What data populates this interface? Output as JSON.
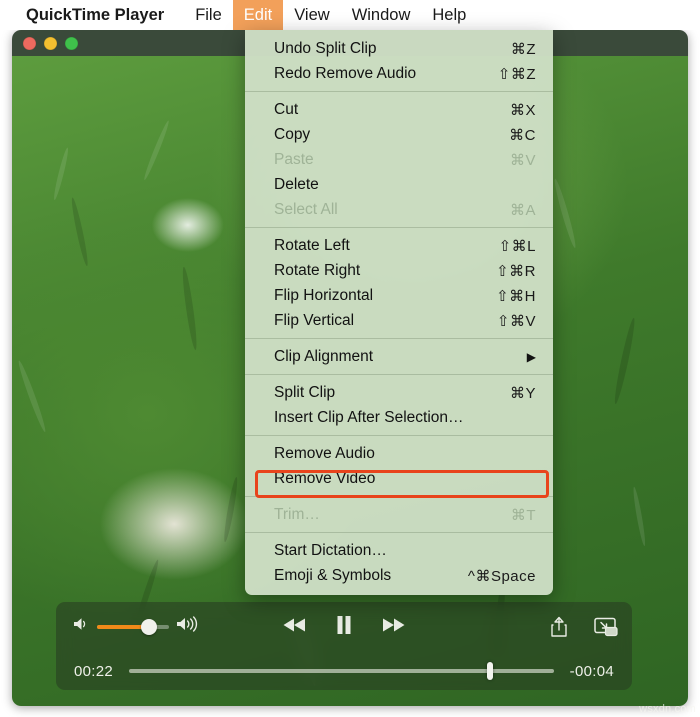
{
  "menubar": {
    "app_name": "QuickTime Player",
    "items": [
      {
        "label": "File",
        "active": false
      },
      {
        "label": "Edit",
        "active": true
      },
      {
        "label": "View",
        "active": false
      },
      {
        "label": "Window",
        "active": false
      },
      {
        "label": "Help",
        "active": false
      }
    ]
  },
  "window": {
    "traffic_lights": {
      "close": "close-button",
      "minimize": "minimize-button",
      "zoom": "zoom-button"
    }
  },
  "edit_menu": {
    "groups": [
      {
        "items": [
          {
            "label": "Undo Split Clip",
            "shortcut": "⌘Z",
            "disabled": false,
            "submenu": false,
            "highlighted": false
          },
          {
            "label": "Redo Remove Audio",
            "shortcut": "⇧⌘Z",
            "disabled": false,
            "submenu": false,
            "highlighted": false
          }
        ]
      },
      {
        "items": [
          {
            "label": "Cut",
            "shortcut": "⌘X",
            "disabled": false,
            "submenu": false,
            "highlighted": false
          },
          {
            "label": "Copy",
            "shortcut": "⌘C",
            "disabled": false,
            "submenu": false,
            "highlighted": false
          },
          {
            "label": "Paste",
            "shortcut": "⌘V",
            "disabled": true,
            "submenu": false,
            "highlighted": false
          },
          {
            "label": "Delete",
            "shortcut": "",
            "disabled": false,
            "submenu": false,
            "highlighted": false
          },
          {
            "label": "Select All",
            "shortcut": "⌘A",
            "disabled": true,
            "submenu": false,
            "highlighted": false
          }
        ]
      },
      {
        "items": [
          {
            "label": "Rotate Left",
            "shortcut": "⇧⌘L",
            "disabled": false,
            "submenu": false,
            "highlighted": false
          },
          {
            "label": "Rotate Right",
            "shortcut": "⇧⌘R",
            "disabled": false,
            "submenu": false,
            "highlighted": false
          },
          {
            "label": "Flip Horizontal",
            "shortcut": "⇧⌘H",
            "disabled": false,
            "submenu": false,
            "highlighted": false
          },
          {
            "label": "Flip Vertical",
            "shortcut": "⇧⌘V",
            "disabled": false,
            "submenu": false,
            "highlighted": false
          }
        ]
      },
      {
        "items": [
          {
            "label": "Clip Alignment",
            "shortcut": "",
            "disabled": false,
            "submenu": true,
            "highlighted": false
          }
        ]
      },
      {
        "items": [
          {
            "label": "Split Clip",
            "shortcut": "⌘Y",
            "disabled": false,
            "submenu": false,
            "highlighted": false
          },
          {
            "label": "Insert Clip After Selection…",
            "shortcut": "",
            "disabled": false,
            "submenu": false,
            "highlighted": false
          }
        ]
      },
      {
        "items": [
          {
            "label": "Remove Audio",
            "shortcut": "",
            "disabled": false,
            "submenu": false,
            "highlighted": true
          },
          {
            "label": "Remove Video",
            "shortcut": "",
            "disabled": false,
            "submenu": false,
            "highlighted": false
          }
        ]
      },
      {
        "items": [
          {
            "label": "Trim…",
            "shortcut": "⌘T",
            "disabled": true,
            "submenu": false,
            "highlighted": false
          }
        ]
      },
      {
        "items": [
          {
            "label": "Start Dictation…",
            "shortcut": "",
            "disabled": false,
            "submenu": false,
            "highlighted": false
          },
          {
            "label": "Emoji & Symbols",
            "shortcut": "^⌘Space",
            "disabled": false,
            "submenu": false,
            "highlighted": false
          }
        ]
      }
    ],
    "submenu_arrow": "▶",
    "highlight_color": "#e8441c"
  },
  "player_controls": {
    "volume_icon_low": "speaker-low-icon",
    "volume_icon_high": "speaker-high-icon",
    "volume_percent": 72,
    "volume_fill_color": "#f08a19",
    "rewind_label": "rewind-button",
    "pause_label": "pause-button",
    "forward_label": "fast-forward-button",
    "share_label": "share-button",
    "pip_label": "picture-in-picture-button",
    "elapsed_time": "00:22",
    "remaining_time": "-00:04",
    "progress_percent": 85
  },
  "watermark": {
    "text": "wsxdn.com"
  }
}
